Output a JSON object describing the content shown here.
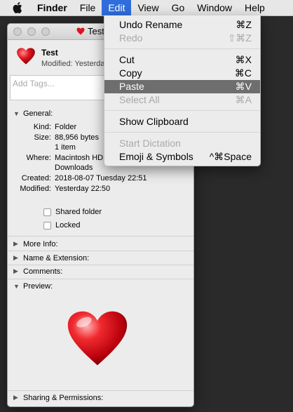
{
  "menubar": {
    "app": "Finder",
    "items": [
      "File",
      "Edit",
      "View",
      "Go",
      "Window",
      "Help"
    ]
  },
  "window": {
    "title": "Test",
    "name": "Test",
    "modified_line": "Modified: Yesterday",
    "tags_placeholder": "Add Tags...",
    "general": {
      "header": "General:",
      "kind_label": "Kind:",
      "kind_value": "Folder",
      "size_label": "Size:",
      "size_value": "88,956 bytes",
      "size_items": "1 item",
      "where_label": "Where:",
      "where_value": "Macintosh HD",
      "where_value2": "Downloads",
      "created_label": "Created:",
      "created_value": "2018-08-07 Tuesday 22:51",
      "modified_label": "Modified:",
      "modified_value": "Yesterday 22:50",
      "shared_folder": "Shared folder",
      "locked": "Locked"
    },
    "sections": {
      "more_info": "More Info:",
      "name_ext": "Name & Extension:",
      "comments": "Comments:",
      "preview": "Preview:",
      "sharing": "Sharing & Permissions:"
    }
  },
  "edit_menu": {
    "undo": {
      "label": "Undo Rename",
      "shortcut": "⌘Z"
    },
    "redo": {
      "label": "Redo",
      "shortcut": "⇧⌘Z"
    },
    "cut": {
      "label": "Cut",
      "shortcut": "⌘X"
    },
    "copy": {
      "label": "Copy",
      "shortcut": "⌘C"
    },
    "paste": {
      "label": "Paste",
      "shortcut": "⌘V"
    },
    "select_all": {
      "label": "Select All",
      "shortcut": "⌘A"
    },
    "show_clipboard": {
      "label": "Show Clipboard"
    },
    "start_dictation": {
      "label": "Start Dictation"
    },
    "emoji": {
      "label": "Emoji & Symbols",
      "shortcut": "^⌘Space"
    }
  },
  "colors": {
    "menu_highlight": "#6e6e6e",
    "menubar_active": "#2f6ddc",
    "heart_red": "#e0141e"
  },
  "icons": [
    "apple-icon",
    "heart-icon"
  ]
}
